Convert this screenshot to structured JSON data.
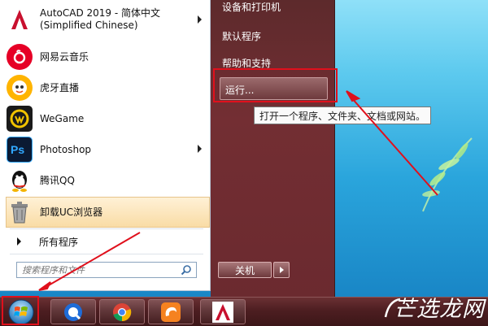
{
  "start_menu": {
    "programs": [
      {
        "label": "AutoCAD 2019 - 简体中文 (Simplified Chinese)",
        "icon": "autocad-icon",
        "has_submenu": true
      },
      {
        "label": "网易云音乐",
        "icon": "netease-music-icon",
        "has_submenu": false
      },
      {
        "label": "虎牙直播",
        "icon": "huya-icon",
        "has_submenu": false
      },
      {
        "label": "WeGame",
        "icon": "wegame-icon",
        "has_submenu": false
      },
      {
        "label": "Photoshop",
        "icon": "photoshop-icon",
        "has_submenu": true
      },
      {
        "label": "腾讯QQ",
        "icon": "qq-icon",
        "has_submenu": false
      },
      {
        "label": "卸载UC浏览器",
        "icon": "uninstall-icon",
        "has_submenu": false,
        "highlighted": true
      }
    ],
    "all_programs": "所有程序",
    "search": {
      "placeholder": "搜索程序和文件"
    },
    "right_items": [
      "设备和打印机",
      "默认程序",
      "帮助和支持"
    ],
    "run": "运行...",
    "tooltip": "打开一个程序、文件夹、文档或网站。",
    "shutdown": "关机"
  },
  "taskbar": {
    "pinned": [
      "start-orb-icon",
      "quicktime-icon",
      "chrome-icon",
      "uc-browser-icon",
      "autocad-icon"
    ]
  },
  "watermark": {
    "text": "芒选龙网"
  },
  "colors": {
    "annotation_red": "#e0101c",
    "right_panel": "#6b2a2f",
    "highlight": "#f9dca6"
  }
}
